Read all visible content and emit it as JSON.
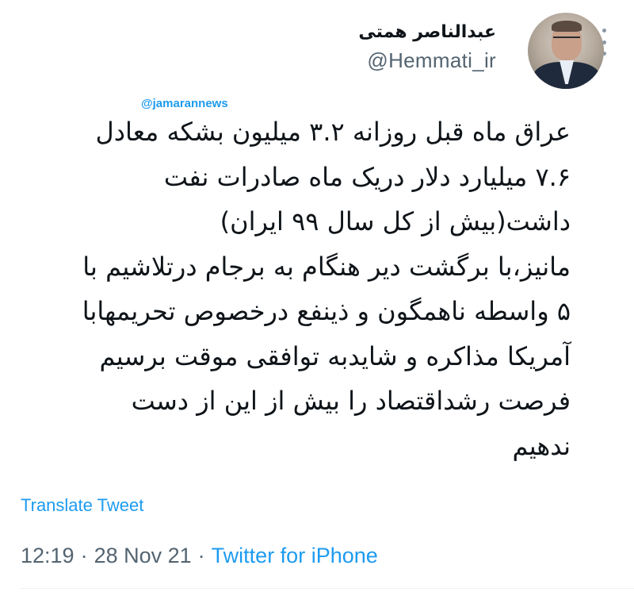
{
  "tweet": {
    "author": {
      "display_name": "عبدالناصر همتی",
      "handle": "@Hemmati_ir"
    },
    "watermark": "@jamarannews",
    "text_lines": [
      "عراق ماه قبل روزانه ۳.۲ میلیون بشکه معادل",
      "۷.۶ میلیارد دلار دریک ماه صادرات نفت",
      "داشت(بیش از کل سال ۹۹ ایران)",
      "مانیز،با برگشت دیر هنگام به برجام درتلاشیم با",
      "۵ واسطه ناهمگون و ذینفع درخصوص تحریمهابا",
      "آمریکا مذاکره و شایدبه توافقی موقت برسیم",
      "فرصت رشداقتصاد را بیش از این از دست",
      "ندهیم"
    ],
    "translate_label": "Translate Tweet",
    "time": "12:19",
    "date": "28 Nov 21",
    "separator": "·",
    "source": "Twitter for iPhone"
  },
  "colors": {
    "text": "#0f1419",
    "muted": "#536471",
    "accent": "#1d9bf0",
    "divider": "#eff3f4"
  },
  "icons": {
    "more": "more-vertical-icon"
  }
}
